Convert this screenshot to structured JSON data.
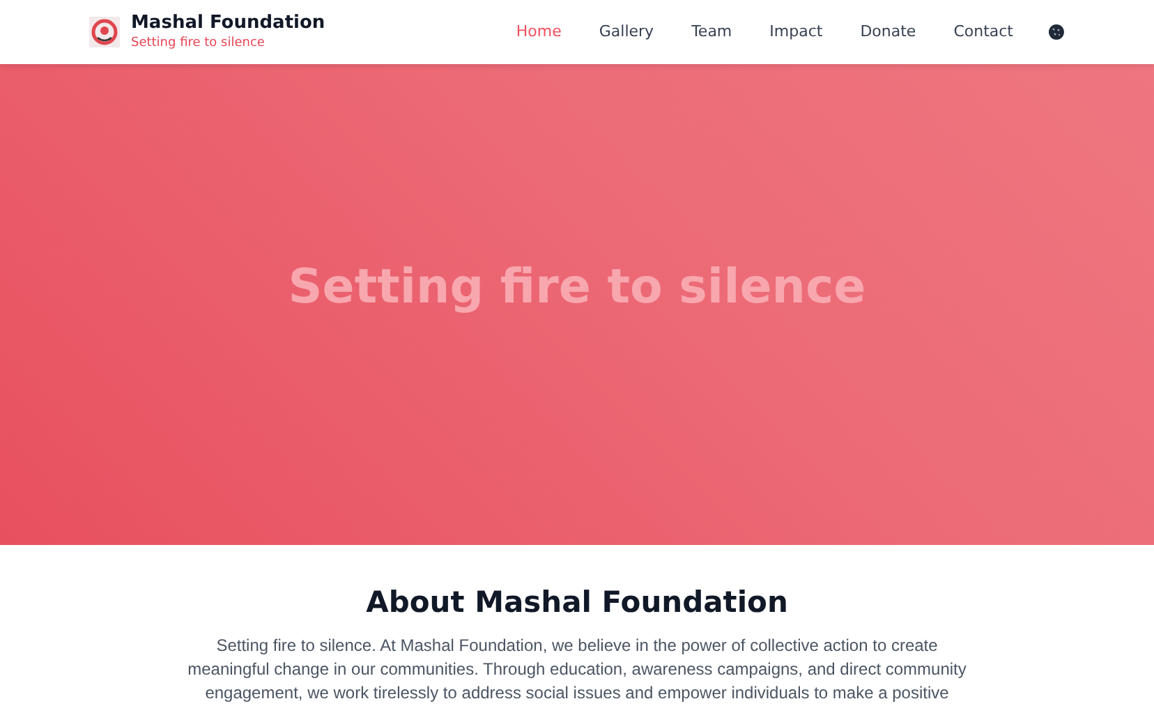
{
  "brand": {
    "name": "Mashal Foundation",
    "tagline": "Setting fire to silence"
  },
  "nav": [
    {
      "label": "Home",
      "selected": true
    },
    {
      "label": "Gallery",
      "selected": false
    },
    {
      "label": "Team",
      "selected": false
    },
    {
      "label": "Impact",
      "selected": false
    },
    {
      "label": "Donate",
      "selected": false
    },
    {
      "label": "Contact",
      "selected": false
    }
  ],
  "hero": {
    "title": "Setting fire to silence"
  },
  "about": {
    "title": "About Mashal Foundation",
    "text": "Setting fire to silence. At Mashal Foundation, we believe in the power of collective action to create meaningful change in our communities. Through education, awareness campaigns, and direct community engagement, we work tirelessly to address social issues and empower individuals to make a positive"
  }
}
